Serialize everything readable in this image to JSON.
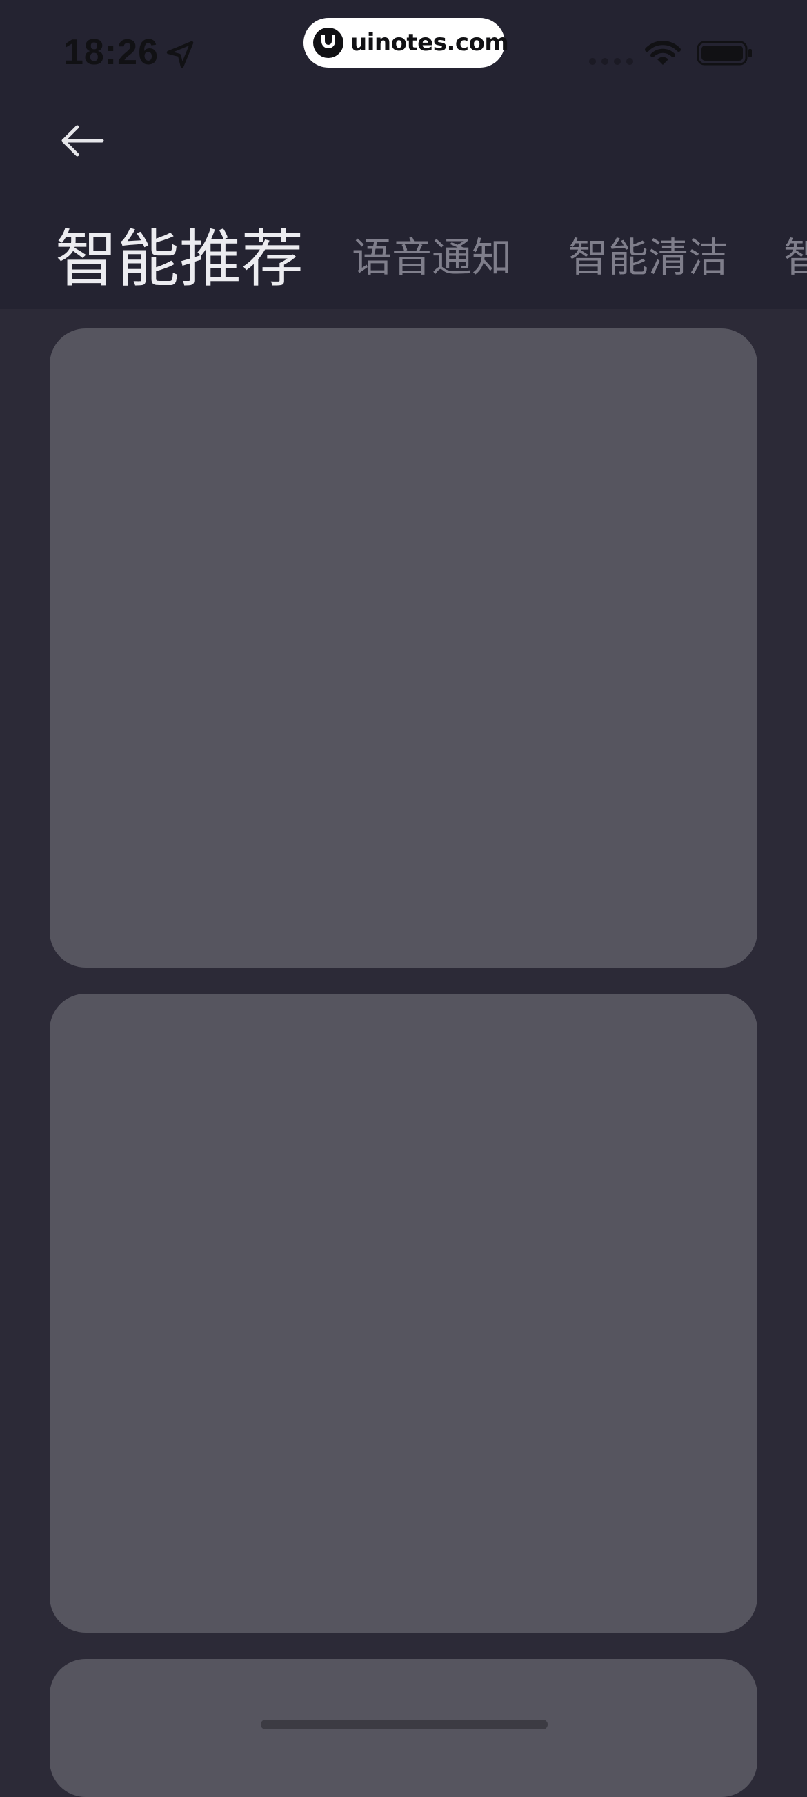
{
  "status_bar": {
    "time": "18:26",
    "location_icon": "location-arrow-icon",
    "signal_icon": "cellular-signal-icon",
    "wifi_icon": "wifi-icon",
    "battery_icon": "battery-icon"
  },
  "watermark": {
    "text": "uinotes.com",
    "logo_icon": "uinotes-logo-icon"
  },
  "nav": {
    "back_icon": "arrow-left-icon"
  },
  "tabs": [
    {
      "label": "智能推荐",
      "active": true
    },
    {
      "label": "语音通知",
      "active": false
    },
    {
      "label": "智能清洁",
      "active": false
    },
    {
      "label": "智",
      "active": false
    }
  ],
  "cards": [
    {
      "state": "placeholder"
    },
    {
      "state": "placeholder"
    },
    {
      "state": "placeholder"
    }
  ],
  "colors": {
    "header_background": "#242331",
    "page_background": "#2c2a37",
    "card_background": "#56555f",
    "active_tab": "#ececf0",
    "inactive_tab": "#7f7e8b"
  }
}
